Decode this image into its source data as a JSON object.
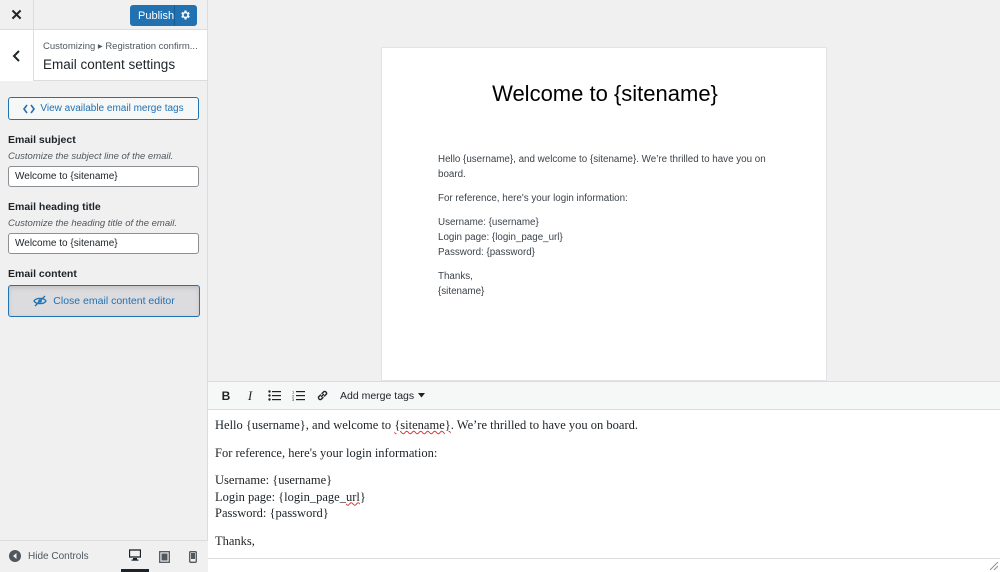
{
  "topbar": {
    "publish_label": "Publish"
  },
  "section": {
    "breadcrumb": "Customizing ▸ Registration confirm...",
    "title": "Email content settings"
  },
  "panel": {
    "merge_tags_button": "View available email merge tags",
    "subject": {
      "label": "Email subject",
      "description": "Customize the subject line of the email.",
      "value": "Welcome to {sitename}"
    },
    "heading": {
      "label": "Email heading title",
      "description": "Customize the heading title of the email.",
      "value": "Welcome to {sitename}"
    },
    "content": {
      "label": "Email content",
      "close_editor_button": "Close email content editor"
    }
  },
  "footer": {
    "hide_controls": "Hide Controls",
    "active_device": "desktop"
  },
  "preview": {
    "heading": "Welcome to {sitename}",
    "para1": "Hello {username}, and welcome to {sitename}. We’re thrilled to have you on board.",
    "para2": "For reference, here's your login information:",
    "line_username": "Username: {username}",
    "line_login": "Login page: {login_page_url}",
    "line_password": "Password: {password}",
    "thanks": "Thanks,",
    "signature": "{sitename}"
  },
  "editor": {
    "toolbar": {
      "merge_tags_dropdown": "Add merge tags"
    },
    "para1_before": "Hello {username}, and welcome to ",
    "para1_spell": "{sitename}",
    "para1_after": ". We’re thrilled to have you on board.",
    "para2": "For reference, here's your login information:",
    "line_username": "Username: {username}",
    "line_login_before": "Login page: {login_page_",
    "line_login_spell": "url",
    "line_login_after": "}",
    "line_password": "Password: {password}",
    "thanks": "Thanks,"
  },
  "colors": {
    "accent": "#2271b1",
    "background": "#f0f0f1",
    "spellcheck": "#d63638"
  }
}
